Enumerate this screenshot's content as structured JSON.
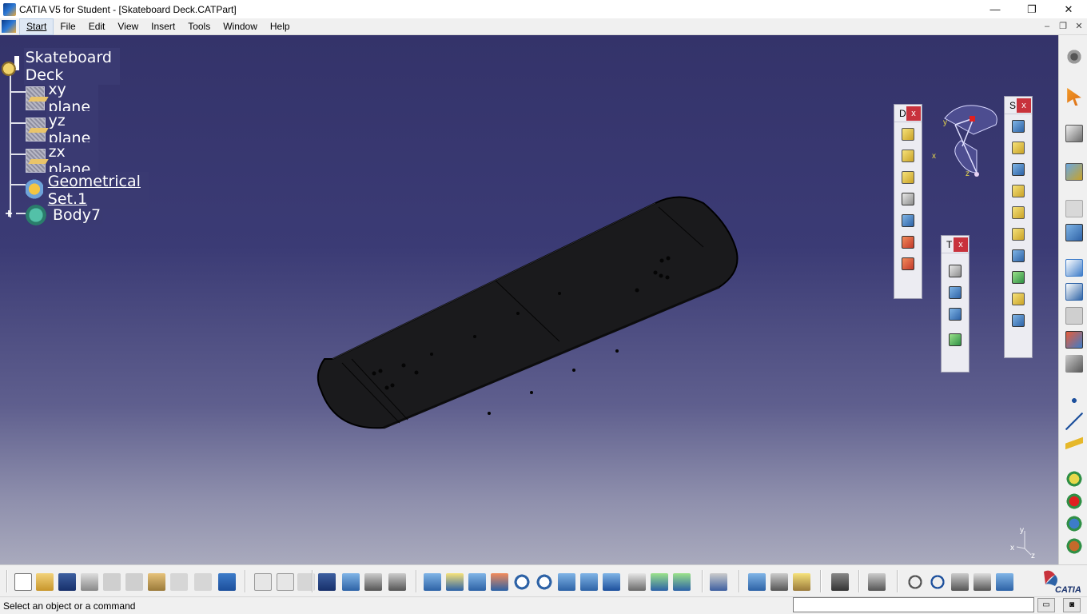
{
  "window": {
    "title": "CATIA V5 for Student - [Skateboard Deck.CATPart]",
    "minimize": "—",
    "maximize": "❐",
    "close": "✕"
  },
  "menu": {
    "items": [
      {
        "label": "Start"
      },
      {
        "label": "File"
      },
      {
        "label": "Edit"
      },
      {
        "label": "View"
      },
      {
        "label": "Insert"
      },
      {
        "label": "Tools"
      },
      {
        "label": "Window"
      },
      {
        "label": "Help"
      }
    ],
    "doc_minimize": "–",
    "doc_restore": "❐",
    "doc_close": "✕"
  },
  "tree": {
    "root": "Skateboard Deck",
    "items": [
      {
        "label": "xy plane",
        "icon": "plane-icon"
      },
      {
        "label": "yz plane",
        "icon": "plane-icon"
      },
      {
        "label": "zx plane",
        "icon": "plane-icon"
      },
      {
        "label": "Geometrical Set.1",
        "icon": "geometrical-set-icon"
      },
      {
        "label": "Body7",
        "icon": "body-icon"
      }
    ]
  },
  "floating_toolbars": {
    "d": {
      "label": "D",
      "close": "x"
    },
    "t": {
      "label": "T",
      "close": "x"
    },
    "s": {
      "label": "S",
      "close": "x"
    }
  },
  "compass": {
    "x_label": "x",
    "y_label": "y",
    "z_label": "z"
  },
  "axis_mini": {
    "x_label": "x",
    "y_label": "y",
    "z_label": "z"
  },
  "status": {
    "message": "Select an object or a command",
    "command_input": ""
  },
  "logo": {
    "text": "CATIA"
  },
  "colors": {
    "viewport_top": "#34336a",
    "viewport_bottom": "#a9aabd",
    "deck": "#1a1a1c",
    "tree_text": "#ffffff"
  }
}
